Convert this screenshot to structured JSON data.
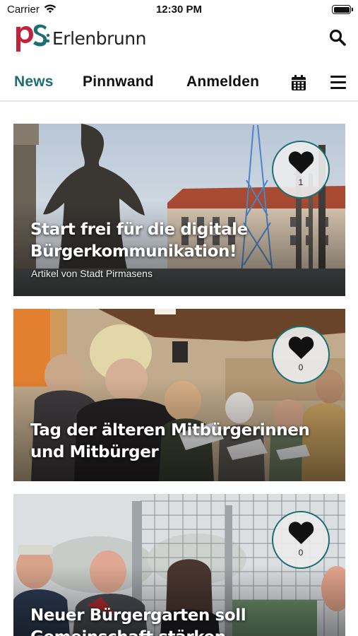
{
  "status_bar": {
    "carrier": "Carrier",
    "time": "12:30 PM"
  },
  "header": {
    "logo_text": "Erlenbrunn",
    "logo_mark": "pS",
    "logo_colors": {
      "p": "#c0233a",
      "s": "#1d6e72"
    }
  },
  "nav": {
    "tabs": [
      {
        "label": "News",
        "active": true
      },
      {
        "label": "Pinnwand",
        "active": false
      },
      {
        "label": "Anmelden",
        "active": false
      }
    ],
    "icons": [
      "calendar-icon",
      "hamburger-menu-icon"
    ]
  },
  "feed": [
    {
      "title": "Start frei für die digitale Bürgerkommunikation!",
      "subtitle": "Artikel von Stadt Pirmasens",
      "likes": "1"
    },
    {
      "title": "Tag der älteren Mitbürgerinnen und Mitbürger",
      "subtitle": "",
      "likes": "0"
    },
    {
      "title": "Neuer Bürgergarten soll Gemeinschaft stärken",
      "subtitle": "",
      "likes": "0"
    }
  ],
  "colors": {
    "accent": "#1d6e72",
    "brand_red": "#c0233a",
    "text": "#111111"
  }
}
